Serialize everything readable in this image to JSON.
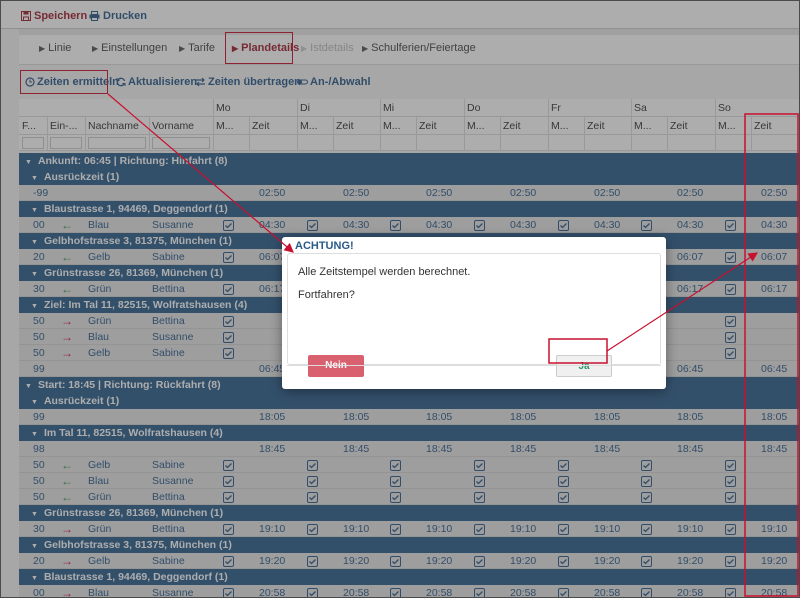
{
  "toolbar": {
    "save_label": "Speichern",
    "print_label": "Drucken"
  },
  "tabs": [
    {
      "label": "Linie",
      "state": "normal"
    },
    {
      "label": "Einstellungen",
      "state": "normal"
    },
    {
      "label": "Tarife",
      "state": "normal"
    },
    {
      "label": "Plandetails",
      "state": "active"
    },
    {
      "label": "Istdetails",
      "state": "disabled"
    },
    {
      "label": "Schulferien/Feiertage",
      "state": "normal"
    }
  ],
  "actions": [
    {
      "label": "Zeiten ermitteln",
      "icon": "clock-icon"
    },
    {
      "label": "Aktualisieren",
      "icon": "refresh-icon"
    },
    {
      "label": "Zeiten übertragen",
      "icon": "transfer-icon"
    },
    {
      "label": "An-/Abwahl",
      "icon": "toggle-icon"
    }
  ],
  "table": {
    "days": [
      "Mo",
      "Di",
      "Mi",
      "Do",
      "Fr",
      "Sa",
      "So"
    ],
    "columns": [
      "F...",
      "Ein-...",
      "Nachname",
      "Vorname",
      "M...",
      "Zeit"
    ],
    "rows": [
      {
        "type": "group",
        "level": 1,
        "label": "Ankunft: 06:45 | Richtung: Hinfahrt (8)"
      },
      {
        "type": "group",
        "level": 2,
        "label": "Ausrückzeit (1)"
      },
      {
        "type": "data",
        "f": "-99",
        "dir": "",
        "last": "",
        "first": "",
        "check": false,
        "times": [
          "02:50",
          "02:50",
          "02:50",
          "02:50",
          "02:50",
          "02:50",
          "02:50"
        ]
      },
      {
        "type": "group",
        "level": 2,
        "label": "Blaustrasse 1, 94469, Deggendorf (1)"
      },
      {
        "type": "data",
        "f": "00",
        "dir": "in",
        "last": "Blau",
        "first": "Susanne",
        "check": true,
        "times": [
          "04:30",
          "04:30",
          "04:30",
          "04:30",
          "04:30",
          "04:30",
          "04:30"
        ]
      },
      {
        "type": "group",
        "level": 2,
        "label": "Gelbhofstrasse 3, 81375, München (1)"
      },
      {
        "type": "data",
        "f": "20",
        "dir": "in",
        "last": "Gelb",
        "first": "Sabine",
        "check": true,
        "times": [
          "06:07",
          "",
          "",
          "",
          "",
          "06:07",
          "06:07"
        ]
      },
      {
        "type": "group",
        "level": 2,
        "label": "Grünstrasse 26, 81369, München (1)"
      },
      {
        "type": "data",
        "f": "30",
        "dir": "in",
        "last": "Grün",
        "first": "Bettina",
        "check": true,
        "times": [
          "06:17",
          "",
          "",
          "",
          "",
          "06:17",
          "06:17"
        ]
      },
      {
        "type": "group",
        "level": 2,
        "label": "Ziel: Im Tal 11, 82515, Wolfratshausen (4)"
      },
      {
        "type": "data",
        "f": "50",
        "dir": "out",
        "last": "Grün",
        "first": "Bettina",
        "check": true,
        "times": [
          "",
          "",
          "",
          "",
          "",
          "",
          ""
        ]
      },
      {
        "type": "data",
        "f": "50",
        "dir": "out",
        "last": "Blau",
        "first": "Susanne",
        "check": true,
        "times": [
          "",
          "",
          "",
          "",
          "",
          "",
          ""
        ]
      },
      {
        "type": "data",
        "f": "50",
        "dir": "out",
        "last": "Gelb",
        "first": "Sabine",
        "check": true,
        "times": [
          "",
          "",
          "",
          "",
          "",
          "",
          ""
        ]
      },
      {
        "type": "data",
        "f": "99",
        "dir": "",
        "last": "",
        "first": "",
        "check": false,
        "times": [
          "06:45",
          "",
          "",
          "",
          "",
          "06:45",
          "06:45"
        ]
      },
      {
        "type": "group",
        "level": 1,
        "label": "Start: 18:45 | Richtung: Rückfahrt (8)"
      },
      {
        "type": "group",
        "level": 2,
        "label": "Ausrückzeit (1)"
      },
      {
        "type": "data",
        "f": "99",
        "dir": "",
        "last": "",
        "first": "",
        "check": false,
        "times": [
          "18:05",
          "18:05",
          "18:05",
          "18:05",
          "18:05",
          "18:05",
          "18:05"
        ]
      },
      {
        "type": "group",
        "level": 2,
        "label": "Im Tal 11, 82515, Wolfratshausen (4)"
      },
      {
        "type": "data",
        "f": "98",
        "dir": "",
        "last": "",
        "first": "",
        "check": false,
        "times": [
          "18:45",
          "18:45",
          "18:45",
          "18:45",
          "18:45",
          "18:45",
          "18:45"
        ]
      },
      {
        "type": "data",
        "f": "50",
        "dir": "in",
        "last": "Gelb",
        "first": "Sabine",
        "check": true,
        "times": [
          "",
          "",
          "",
          "",
          "",
          "",
          ""
        ]
      },
      {
        "type": "data",
        "f": "50",
        "dir": "in",
        "last": "Blau",
        "first": "Susanne",
        "check": true,
        "times": [
          "",
          "",
          "",
          "",
          "",
          "",
          ""
        ]
      },
      {
        "type": "data",
        "f": "50",
        "dir": "in",
        "last": "Grün",
        "first": "Bettina",
        "check": true,
        "times": [
          "",
          "",
          "",
          "",
          "",
          "",
          ""
        ]
      },
      {
        "type": "group",
        "level": 2,
        "label": "Grünstrasse 26, 81369, München (1)"
      },
      {
        "type": "data",
        "f": "30",
        "dir": "out",
        "last": "Grün",
        "first": "Bettina",
        "check": true,
        "times": [
          "19:10",
          "19:10",
          "19:10",
          "19:10",
          "19:10",
          "19:10",
          "19:10"
        ]
      },
      {
        "type": "group",
        "level": 2,
        "label": "Gelbhofstrasse 3, 81375, München (1)"
      },
      {
        "type": "data",
        "f": "20",
        "dir": "out",
        "last": "Gelb",
        "first": "Sabine",
        "check": true,
        "times": [
          "19:20",
          "19:20",
          "19:20",
          "19:20",
          "19:20",
          "19:20",
          "19:20"
        ]
      },
      {
        "type": "group",
        "level": 2,
        "label": "Blaustrasse 1, 94469, Deggendorf (1)"
      },
      {
        "type": "data",
        "f": "00",
        "dir": "out",
        "last": "Blau",
        "first": "Susanne",
        "check": true,
        "times": [
          "20:58",
          "20:58",
          "20:58",
          "20:58",
          "20:58",
          "20:58",
          "20:58"
        ]
      }
    ]
  },
  "dialog": {
    "title": "ACHTUNG!",
    "message": "Alle Zeitstempel werden berechnet.",
    "question": "Fortfahren?",
    "cancel_label": "Nein",
    "confirm_label": "Ja"
  },
  "colors": {
    "group_bg": "#2d5f8e",
    "accent_red": "#c8102e",
    "link_blue": "#2a5a8a",
    "confirm_green": "#2a9a6a",
    "cancel_red": "#d9606e"
  }
}
